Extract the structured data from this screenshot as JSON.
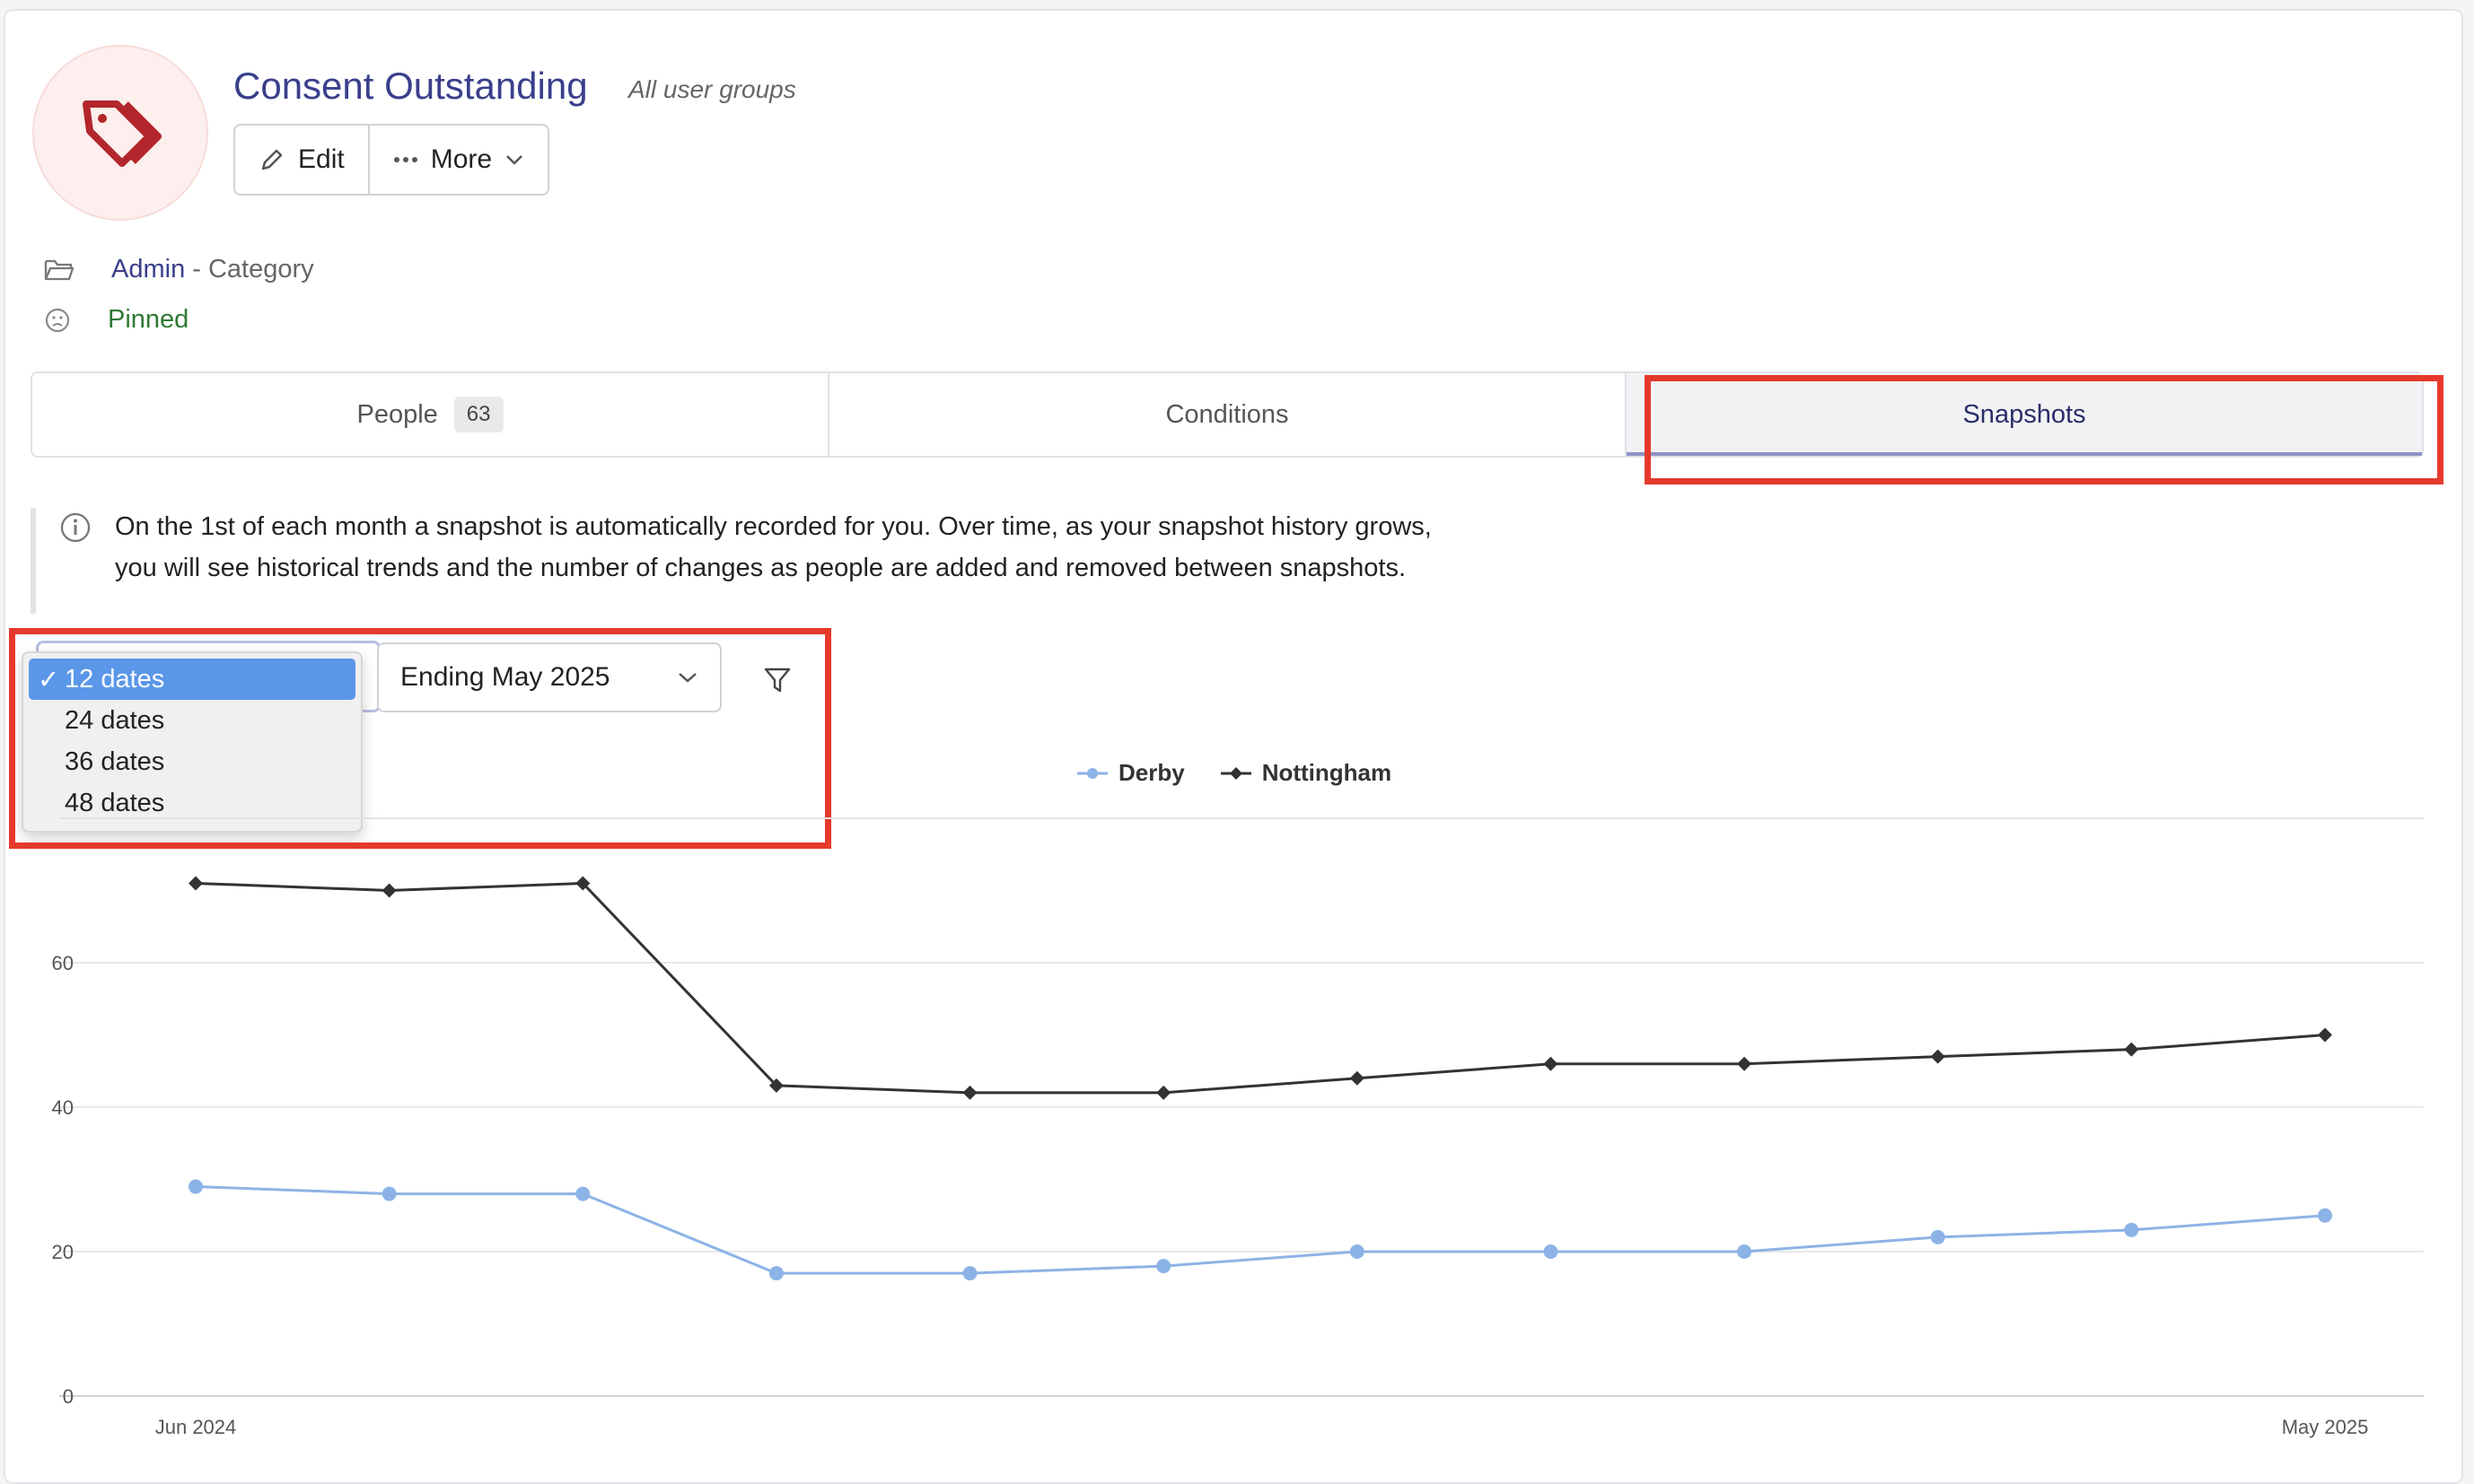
{
  "header": {
    "title": "Consent Outstanding",
    "subtitle": "All user groups",
    "edit_label": "Edit",
    "more_label": "More"
  },
  "meta": {
    "category_link": "Admin",
    "category_suffix": "- Category",
    "pinned": "Pinned"
  },
  "tabs": [
    {
      "label": "People",
      "badge": "63"
    },
    {
      "label": "Conditions"
    },
    {
      "label": "Snapshots",
      "active": true
    }
  ],
  "info": {
    "line1": "On the 1st of each month a snapshot is automatically recorded for you. Over time, as your snapshot history grows,",
    "line2": "you will see historical trends and the number of changes as people are added and removed between snapshots."
  },
  "controls": {
    "range_options": [
      "12 dates",
      "24 dates",
      "36 dates",
      "48 dates"
    ],
    "range_selected": "12 dates",
    "check_mark": "✓",
    "ending_label": "Ending May 2025"
  },
  "colors": {
    "derby": "#8cb3e6",
    "nottingham": "#333333",
    "highlight": "#e5392b",
    "accent": "#3a3f8c"
  },
  "chart_data": {
    "type": "line",
    "x_tick_labels": [
      "Jun 2024",
      "May 2025"
    ],
    "x": [
      "Jun 2024",
      "Jul 2024",
      "Aug 2024",
      "Sep 2024",
      "Oct 2024",
      "Nov 2024",
      "Dec 2024",
      "Jan 2025",
      "Feb 2025",
      "Mar 2025",
      "Apr 2025",
      "May 2025"
    ],
    "series": [
      {
        "name": "Derby",
        "values": [
          29,
          28,
          28,
          17,
          17,
          18,
          20,
          20,
          20,
          22,
          23,
          25
        ]
      },
      {
        "name": "Nottingham",
        "values": [
          71,
          70,
          71,
          43,
          42,
          42,
          44,
          46,
          46,
          47,
          48,
          50
        ]
      }
    ],
    "y_ticks": [
      0,
      20,
      40,
      60
    ],
    "ylim": [
      0,
      80
    ],
    "grid": true,
    "legend": "top-center"
  }
}
